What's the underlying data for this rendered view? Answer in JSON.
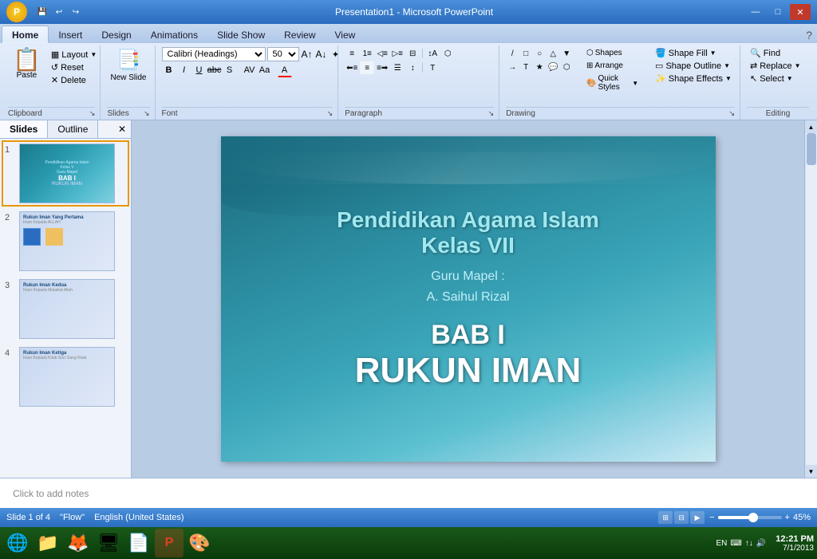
{
  "titlebar": {
    "title": "Presentation1 - Microsoft PowerPoint",
    "office_logo": "★",
    "quick_access": [
      "💾",
      "↩",
      "↪"
    ],
    "min_btn": "—",
    "max_btn": "□",
    "close_btn": "✕"
  },
  "ribbon": {
    "tabs": [
      "Home",
      "Insert",
      "Design",
      "Animations",
      "Slide Show",
      "Review",
      "View"
    ],
    "active_tab": "Home",
    "groups": {
      "clipboard": {
        "label": "Clipboard",
        "paste": "Paste",
        "layout": "Layout",
        "reset": "Reset",
        "delete": "Delete",
        "expand": "↘"
      },
      "slides": {
        "label": "Slides",
        "new_slide": "New Slide",
        "expand": "↘"
      },
      "font": {
        "label": "Font",
        "name": "Calibri (Headings)",
        "size": "50",
        "bold": "B",
        "italic": "I",
        "underline": "U",
        "strikethrough": "ab͟c",
        "shadow": "S",
        "char_spacing": "A̲A̲",
        "change_case": "Aa",
        "font_color": "A",
        "expand": "↘"
      },
      "paragraph": {
        "label": "Paragraph",
        "expand": "↘"
      },
      "drawing": {
        "label": "Drawing",
        "shapes_btn": "Shapes",
        "arrange_btn": "Arrange",
        "quick_styles": "Quick Styles",
        "shape_fill": "Shape Fill",
        "shape_outline": "Shape Outline",
        "shape_effects": "Shape Effects",
        "expand": "↘"
      },
      "editing": {
        "label": "Editing",
        "find": "Find",
        "replace": "Replace",
        "select": "Select"
      }
    }
  },
  "panel": {
    "slides_tab": "Slides",
    "outline_tab": "Outline",
    "close_btn": "✕",
    "slides": [
      {
        "num": "1",
        "title1": "Pendidikan Agama Islam",
        "title2": "Kelas V",
        "info": "Guru Mapel",
        "bab": "BAB I",
        "rukun": "RUKUN IMAN"
      },
      {
        "num": "2",
        "label": "Rukun Iman Yang Pertama",
        "subtitle": "Iman Kepada ALLAH"
      },
      {
        "num": "3",
        "label": "Rukun Iman Kedua",
        "subtitle": "Iman Kepada Malaikat Allah"
      },
      {
        "num": "4",
        "label": "Rukun Iman Ketiga",
        "subtitle": "Iman Kepada Kitab Suci Sang Kitab"
      }
    ]
  },
  "slide": {
    "title1": "Pendidikan Agama Islam",
    "title2": "Kelas VII",
    "info1": "Guru Mapel :",
    "info2": "A. Saihul Rizal",
    "bab": "BAB I",
    "rukun": "RUKUN IMAN"
  },
  "notes": {
    "placeholder": "Click to add notes"
  },
  "statusbar": {
    "slide_info": "Slide 1 of 4",
    "theme": "\"Flow\"",
    "language": "English (United States)",
    "zoom": "45%"
  },
  "taskbar": {
    "icons": [
      "🌐",
      "📁",
      "🦊",
      "🖥",
      "📄",
      "🔴",
      "🎨"
    ],
    "systray": {
      "flag": "EN",
      "keyboard": "⌨",
      "arrows": "↑↓",
      "speaker": "🔊",
      "time": "12:21 PM",
      "date": "7/1/2013"
    }
  }
}
